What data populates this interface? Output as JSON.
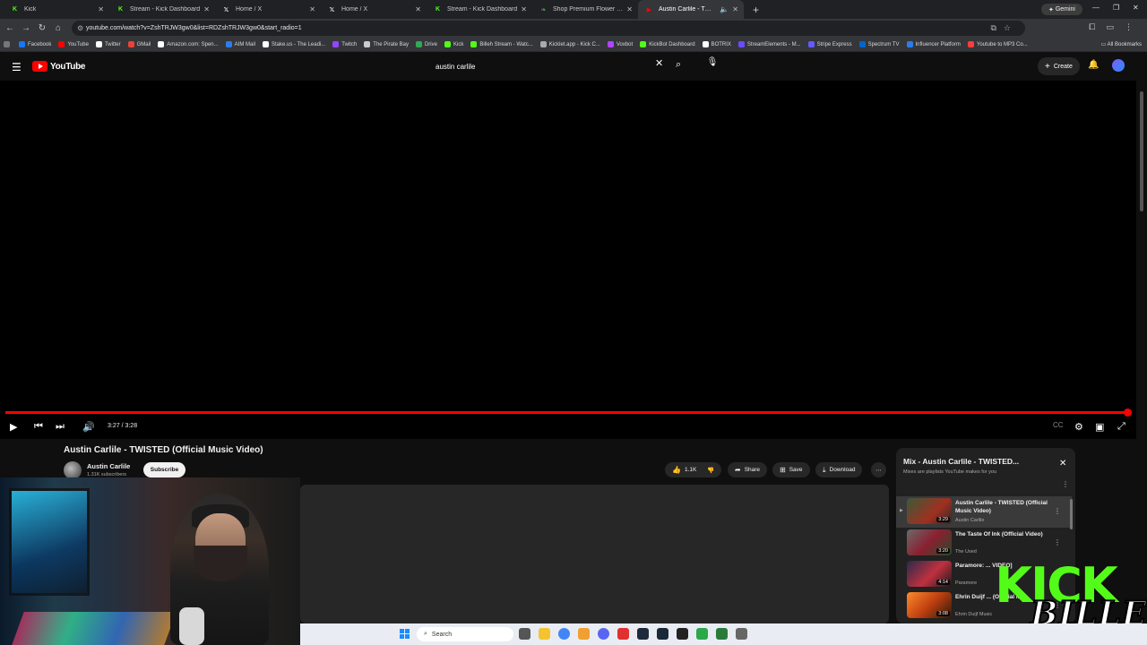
{
  "browser": {
    "tabs": [
      {
        "title": "Kick",
        "icon": "kick-icon",
        "color": "#53fc18",
        "active": false
      },
      {
        "title": "Stream - Kick Dashboard",
        "icon": "kick-icon",
        "color": "#53fc18",
        "active": false
      },
      {
        "title": "Home / X",
        "icon": "x-icon",
        "color": "#ffffff",
        "active": false
      },
      {
        "title": "Home / X",
        "icon": "x-icon",
        "color": "#ffffff",
        "active": false
      },
      {
        "title": "Stream - Kick Dashboard",
        "icon": "kick-icon",
        "color": "#53fc18",
        "active": false
      },
      {
        "title": "Shop Premium Flower | Surter...",
        "icon": "leaf-icon",
        "color": "#4caf50",
        "active": false
      },
      {
        "title": "Austin Carlile - TWISTED (O...",
        "icon": "youtube-icon",
        "color": "#ff0000",
        "active": true
      }
    ],
    "new_tab": "+",
    "gemini_label": "Gemini",
    "url": "youtube.com/watch?v=ZshTRJW3gw0&list=RDZshTRJW3gw0&start_radio=1",
    "bookmarks": [
      {
        "label": "Facebook",
        "color": "#1877f2"
      },
      {
        "label": "YouTube",
        "color": "#ff0000"
      },
      {
        "label": "Twitter",
        "color": "#ffffff"
      },
      {
        "label": "GMail",
        "color": "#ea4335"
      },
      {
        "label": "Amazon.com: Spen...",
        "color": "#ffffff"
      },
      {
        "label": "AIM Mail",
        "color": "#2b7de9"
      },
      {
        "label": "Stake.us - The Leadi...",
        "color": "#ffffff"
      },
      {
        "label": "Twitch",
        "color": "#9146ff"
      },
      {
        "label": "The Pirate Bay",
        "color": "#cccccc"
      },
      {
        "label": "Drive",
        "color": "#34a853"
      },
      {
        "label": "Kick",
        "color": "#53fc18"
      },
      {
        "label": "Billeh Stream - Watc...",
        "color": "#53fc18"
      },
      {
        "label": "Kicklet.app - Kick C...",
        "color": "#aaaaaa"
      },
      {
        "label": "Voxbot",
        "color": "#b044ff"
      },
      {
        "label": "KickBot Dashboard",
        "color": "#53fc18"
      },
      {
        "label": "BOTRIX",
        "color": "#ffffff"
      },
      {
        "label": "StreamElements - M...",
        "color": "#6b4cff"
      },
      {
        "label": "Stripe Express",
        "color": "#635bff"
      },
      {
        "label": "Spectrum TV",
        "color": "#0066cc"
      },
      {
        "label": "Influencer Platform",
        "color": "#2b7de9"
      },
      {
        "label": "Youtube to MP3 Co...",
        "color": "#ff3b3b"
      }
    ],
    "all_bookmarks": "All Bookmarks"
  },
  "youtube": {
    "logo_text": "YouTube",
    "search_value": "austin carlile",
    "create_label": "Create",
    "player": {
      "time": "3:27 / 3:28",
      "progress": 0.995
    },
    "video": {
      "title": "Austin Carlile - TWISTED (Official Music Video)",
      "channel": "Austin Carlile",
      "subscribers": "1.31K subscribers",
      "subscribe_label": "Subscribe",
      "likes": "1.1K",
      "share_label": "Share",
      "save_label": "Save",
      "download_label": "Download"
    },
    "playlist": {
      "title": "Mix - Austin Carlile - TWISTED...",
      "subtitle": "Mixes are playlists YouTube makes for you",
      "items": [
        {
          "title": "Austin Carlile - TWISTED (Official Music Video)",
          "channel": "Austin Carlile",
          "duration": "3:29",
          "active": true
        },
        {
          "title": "The Taste Of Ink (Official Video)",
          "channel": "The Used",
          "duration": "3:20",
          "active": false
        },
        {
          "title": "Paramore: ... VIDEO]",
          "channel": "Paramore",
          "duration": "4:14",
          "active": false
        },
        {
          "title": "Ehrin Duijf ... (Official M...",
          "channel": "Ehrin Duijf Music",
          "duration": "3:08",
          "active": false
        }
      ]
    }
  },
  "overlay": {
    "kick_text": "KICK",
    "billeh_text": "BILLEH"
  },
  "taskbar": {
    "search_label": "Search"
  }
}
